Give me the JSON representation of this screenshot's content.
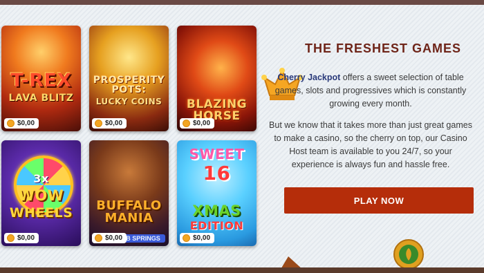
{
  "colors": {
    "accent": "#b52d0a",
    "heading": "#6e2418",
    "brand": "#2a3a7a",
    "coin": "#f3a623"
  },
  "games": [
    {
      "title_line1": "T-REX",
      "title_line2": "LAVA BLITZ",
      "price": "$0,00"
    },
    {
      "title_line1": "PROSPERITY POTS:",
      "title_line2": "LUCKY COINS",
      "price": "$0,00"
    },
    {
      "title_line1": "BLAZING HORSE",
      "price": "$0,00"
    },
    {
      "title_line1": "3x",
      "title_line2": "WOW",
      "title_line3": "WHEELS",
      "price": "$0,00"
    },
    {
      "title_line1": "BUFFALO MANIA",
      "strip_text": "B SPRINGS",
      "price": "$0,00"
    },
    {
      "title_line1": "SWEET",
      "title_line2": "16",
      "title_line3": "XMAS",
      "title_line4": "EDITION",
      "price": "$0,00"
    }
  ],
  "content": {
    "heading": "THE FRESHEST GAMES",
    "brand_name": "Cherry Jackpot",
    "paragraph1_rest": " offers a sweet selection of table games, slots and progressives which is constantly growing every month.",
    "paragraph2": "But we know that it takes more than just great games to make a casino, so the cherry on top, our Casino Host team is available to you 24/7, so your experience is always fun and hassle free.",
    "cta_label": "PLAY NOW"
  },
  "icons": [
    "coin-icon",
    "crown-icon",
    "chip-icon"
  ]
}
